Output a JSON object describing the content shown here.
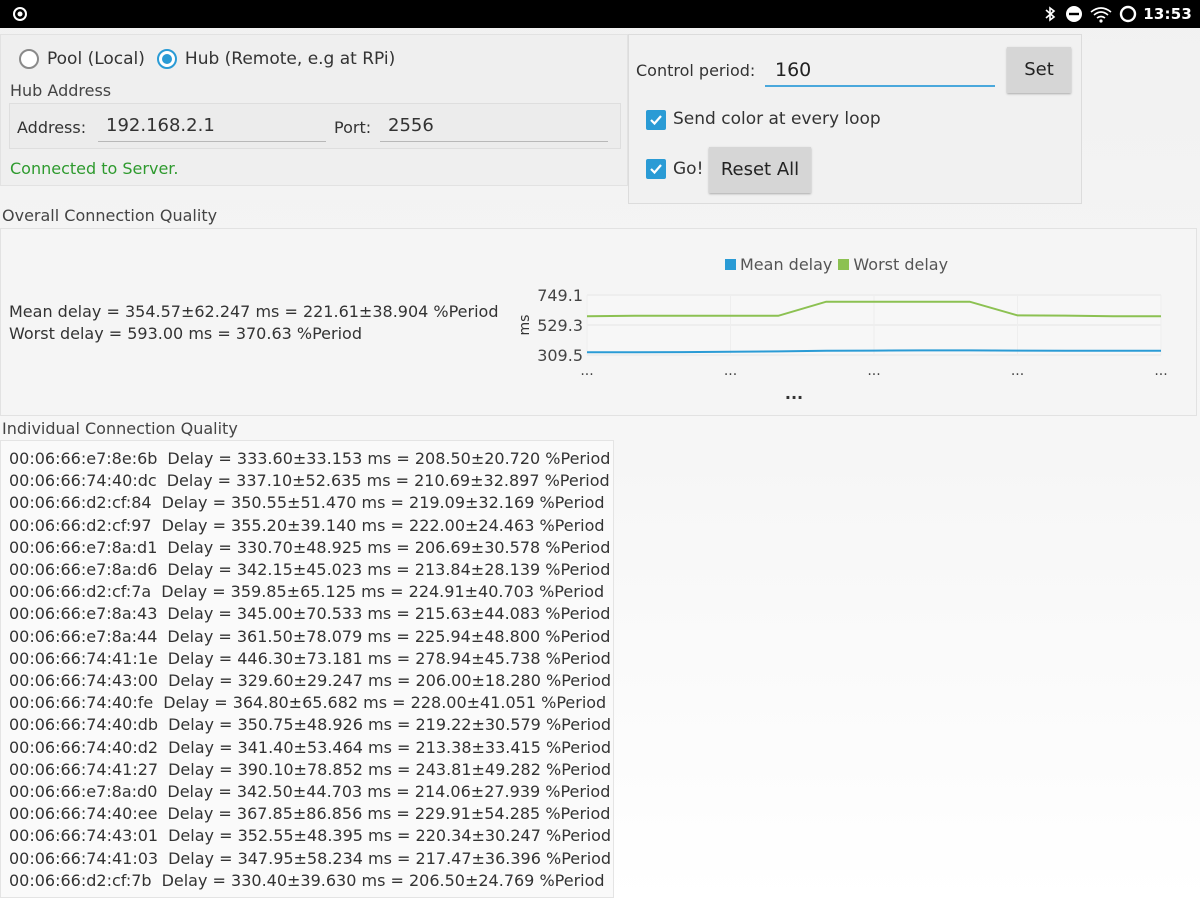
{
  "status_bar": {
    "left_icon": "android-debug-icon",
    "icons": [
      "bluetooth-icon",
      "do-not-disturb-icon",
      "wifi-icon",
      "battery-icon"
    ],
    "time": "13:53"
  },
  "mode": {
    "options": [
      {
        "label": "Pool (Local)",
        "checked": false
      },
      {
        "label": "Hub (Remote, e.g at RPi)",
        "checked": true
      }
    ]
  },
  "hub": {
    "section_title": "Hub Address",
    "address_label": "Address:",
    "address_value": "192.168.2.1",
    "port_label": "Port:",
    "port_value": "2556",
    "connection_status": "Connected to Server."
  },
  "controls": {
    "control_period_label": "Control period:",
    "control_period_value": "160",
    "set_label": "Set",
    "send_color_label": "Send color at every loop",
    "send_color_checked": true,
    "go_label": "Go!",
    "go_checked": true,
    "reset_label": "Reset All"
  },
  "overall": {
    "title": "Overall Connection Quality",
    "mean_line": "Mean delay = 354.57±62.247 ms = 221.61±38.904 %Period",
    "worst_line": "Worst delay = 593.00 ms = 370.63 %Period"
  },
  "chart_data": {
    "type": "line",
    "title": "",
    "ylabel": "ms",
    "xlabel": "...",
    "x_tick_labels": [
      "...",
      "...",
      "...",
      "...",
      "..."
    ],
    "y_tick_labels": [
      "749.1",
      "529.3",
      "309.5"
    ],
    "ylim": [
      309.5,
      749.1
    ],
    "legend_position": "top",
    "x": [
      0,
      1,
      2,
      3,
      4,
      5,
      6,
      7,
      8,
      9,
      10,
      11,
      12
    ],
    "series": [
      {
        "name": "Mean delay",
        "color": "#2a9bd5",
        "values": [
          330,
          330,
          331,
          333,
          336,
          340,
          342,
          343,
          343,
          342,
          341,
          341,
          341
        ]
      },
      {
        "name": "Worst delay",
        "color": "#8cc152",
        "values": [
          593,
          597,
          597,
          597,
          597,
          700,
          700,
          700,
          700,
          600,
          598,
          594,
          593
        ]
      }
    ],
    "grid": true
  },
  "individual": {
    "title": "Individual Connection Quality",
    "rows": [
      {
        "mac": "00:06:66:e7:8e:6b",
        "delay": "Delay = 333.60±33.153 ms = 208.50±20.720 %Period"
      },
      {
        "mac": "00:06:66:74:40:dc",
        "delay": "Delay = 337.10±52.635 ms = 210.69±32.897 %Period"
      },
      {
        "mac": "00:06:66:d2:cf:84",
        "delay": "Delay = 350.55±51.470 ms = 219.09±32.169 %Period"
      },
      {
        "mac": "00:06:66:d2:cf:97",
        "delay": "Delay = 355.20±39.140 ms = 222.00±24.463 %Period"
      },
      {
        "mac": "00:06:66:e7:8a:d1",
        "delay": "Delay = 330.70±48.925 ms = 206.69±30.578 %Period"
      },
      {
        "mac": "00:06:66:e7:8a:d6",
        "delay": "Delay = 342.15±45.023 ms = 213.84±28.139 %Period"
      },
      {
        "mac": "00:06:66:d2:cf:7a",
        "delay": "Delay = 359.85±65.125 ms = 224.91±40.703 %Period"
      },
      {
        "mac": "00:06:66:e7:8a:43",
        "delay": "Delay = 345.00±70.533 ms = 215.63±44.083 %Period"
      },
      {
        "mac": "00:06:66:e7:8a:44",
        "delay": "Delay = 361.50±78.079 ms = 225.94±48.800 %Period"
      },
      {
        "mac": "00:06:66:74:41:1e",
        "delay": "Delay = 446.30±73.181 ms = 278.94±45.738 %Period"
      },
      {
        "mac": "00:06:66:74:43:00",
        "delay": "Delay = 329.60±29.247 ms = 206.00±18.280 %Period"
      },
      {
        "mac": "00:06:66:74:40:fe",
        "delay": "Delay = 364.80±65.682 ms = 228.00±41.051 %Period"
      },
      {
        "mac": "00:06:66:74:40:db",
        "delay": "Delay = 350.75±48.926 ms = 219.22±30.579 %Period"
      },
      {
        "mac": "00:06:66:74:40:d2",
        "delay": "Delay = 341.40±53.464 ms = 213.38±33.415 %Period"
      },
      {
        "mac": "00:06:66:74:41:27",
        "delay": "Delay = 390.10±78.852 ms = 243.81±49.282 %Period"
      },
      {
        "mac": "00:06:66:e7:8a:d0",
        "delay": "Delay = 342.50±44.703 ms = 214.06±27.939 %Period"
      },
      {
        "mac": "00:06:66:74:40:ee",
        "delay": "Delay = 367.85±86.856 ms = 229.91±54.285 %Period"
      },
      {
        "mac": "00:06:66:74:43:01",
        "delay": "Delay = 352.55±48.395 ms = 220.34±30.247 %Period"
      },
      {
        "mac": "00:06:66:74:41:03",
        "delay": "Delay = 347.95±58.234 ms = 217.47±36.396 %Period"
      },
      {
        "mac": "00:06:66:d2:cf:7b",
        "delay": "Delay = 330.40±39.630 ms = 206.50±24.769 %Period"
      }
    ]
  }
}
